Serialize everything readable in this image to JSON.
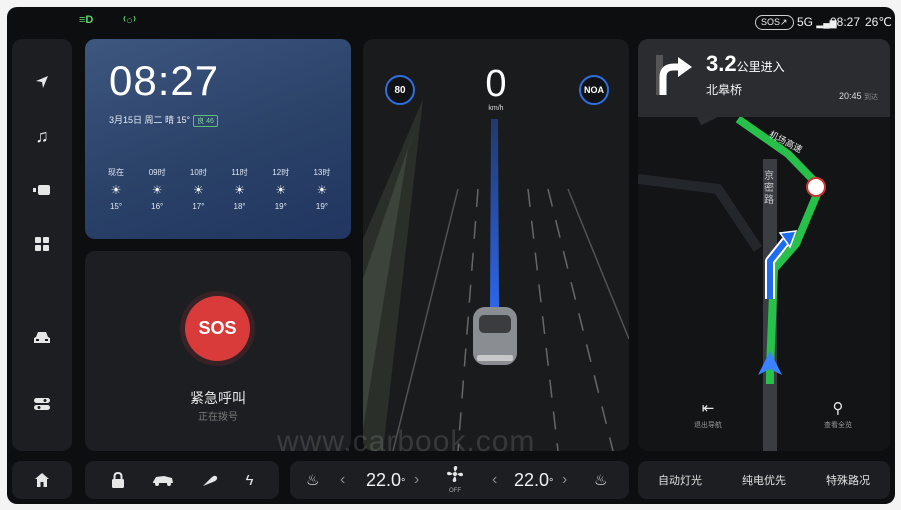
{
  "status_bar": {
    "left_icons": [
      "headlight-icon",
      "parking-light-icon"
    ],
    "sos_label": "SOS",
    "network": "5G",
    "time": "08:27",
    "temperature": "26℃"
  },
  "left_nav": {
    "items": [
      "navigation-icon",
      "music-icon",
      "video-icon",
      "apps-icon",
      "car-icon",
      "settings-toggle-icon"
    ]
  },
  "weather": {
    "time": "08:27",
    "date_line": "3月15日 周二  晴 15°",
    "aqi": "良 46",
    "hours": [
      {
        "label": "现在",
        "temp": "15°"
      },
      {
        "label": "09时",
        "temp": "16°"
      },
      {
        "label": "10时",
        "temp": "17°"
      },
      {
        "label": "11时",
        "temp": "18°"
      },
      {
        "label": "12时",
        "temp": "19°"
      },
      {
        "label": "13时",
        "temp": "19°"
      }
    ]
  },
  "sos": {
    "button": "SOS",
    "title": "紧急呼叫",
    "subtitle": "正在拨号"
  },
  "driving": {
    "speed_limit": "80",
    "speed": "0",
    "unit": "km/h",
    "noa": "NOA"
  },
  "navigation": {
    "distance": "3.2",
    "distance_unit": "公里进入",
    "road": "北皋桥",
    "eta": "20:45",
    "eta_label": "到达",
    "map_road_1": "京密路",
    "map_road_2": "机场高速",
    "exit_label": "退出导航",
    "overview_label": "查看全览"
  },
  "bottom_bar": {
    "left_temp": "22.0",
    "right_temp": "22.0",
    "fan_label": "OFF",
    "buttons": [
      "自动灯光",
      "纯电优先",
      "特殊路况"
    ]
  },
  "watermark": "www.carbook.com",
  "colors": {
    "accent_blue": "#2f6fe0",
    "route_green": "#27c04a",
    "sos_red": "#d93b3b"
  }
}
